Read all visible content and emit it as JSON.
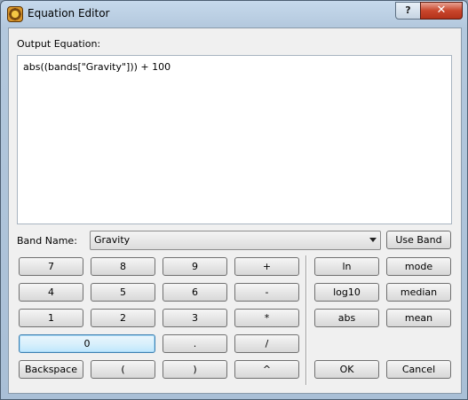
{
  "window": {
    "title": "Equation Editor"
  },
  "titlebar": {
    "help_label": "?",
    "close_label": "✕"
  },
  "output": {
    "label": "Output Equation:",
    "value": "abs((bands[\"Gravity\"])) + 100"
  },
  "band": {
    "label": "Band Name:",
    "selected": "Gravity",
    "use_label": "Use Band"
  },
  "keypad": {
    "k7": "7",
    "k8": "8",
    "k9": "9",
    "plus": "+",
    "k4": "4",
    "k5": "5",
    "k6": "6",
    "minus": "-",
    "k1": "1",
    "k2": "2",
    "k3": "3",
    "times": "*",
    "k0": "0",
    "dot": ".",
    "divide": "/",
    "backspace": "Backspace",
    "lparen": "(",
    "rparen": ")",
    "power": "^"
  },
  "functions": {
    "ln": "ln",
    "mode": "mode",
    "log10": "log10",
    "median": "median",
    "abs": "abs",
    "mean": "mean"
  },
  "actions": {
    "ok": "OK",
    "cancel": "Cancel"
  }
}
